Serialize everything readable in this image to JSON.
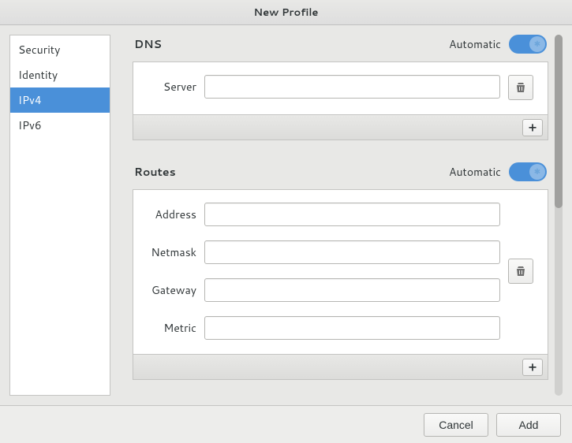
{
  "title": "New Profile",
  "sidebar": {
    "items": [
      {
        "label": "Security",
        "active": false
      },
      {
        "label": "Identity",
        "active": false
      },
      {
        "label": "IPv4",
        "active": true
      },
      {
        "label": "IPv6",
        "active": false
      }
    ]
  },
  "dns": {
    "title": "DNS",
    "automatic_label": "Automatic",
    "automatic_on": true,
    "server_label": "Server",
    "server_value": "",
    "add_label": "+"
  },
  "routes": {
    "title": "Routes",
    "automatic_label": "Automatic",
    "automatic_on": true,
    "address_label": "Address",
    "address_value": "",
    "netmask_label": "Netmask",
    "netmask_value": "",
    "gateway_label": "Gateway",
    "gateway_value": "",
    "metric_label": "Metric",
    "metric_value": "",
    "add_label": "+"
  },
  "buttons": {
    "cancel": "Cancel",
    "add": "Add"
  },
  "icons": {
    "trash": "trash-icon",
    "plus": "plus-icon"
  },
  "colors": {
    "accent": "#4a90d9",
    "panel_bg": "#ffffff",
    "window_bg": "#e8e8e6"
  }
}
